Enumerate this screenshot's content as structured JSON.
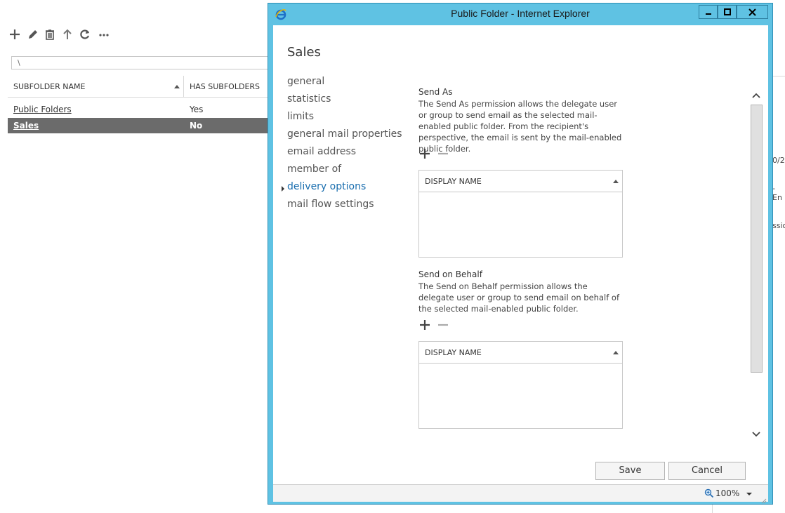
{
  "window": {
    "title": "Public Folder - Internet Explorer"
  },
  "dialog": {
    "title": "Sales",
    "nav": [
      "general",
      "statistics",
      "limits",
      "general mail properties",
      "email address",
      "member of",
      "delivery options",
      "mail flow settings"
    ],
    "active_nav": "delivery options",
    "send_as": {
      "title": "Send As",
      "description": "The Send As permission allows the delegate user or group to send email as the selected mail-enabled public folder. From the recipient's perspective, the email is sent by the mail-enabled public folder.",
      "column": "DISPLAY NAME"
    },
    "send_on_behalf": {
      "title": "Send on Behalf",
      "description": "The Send on Behalf permission allows the delegate user or group to send email on behalf of the selected mail-enabled public folder.",
      "column": "DISPLAY NAME"
    },
    "save_label": "Save",
    "cancel_label": "Cancel"
  },
  "statusbar": {
    "zoom": "100%"
  },
  "background": {
    "path": "\\",
    "columns": [
      "SUBFOLDER NAME",
      "HAS SUBFOLDERS"
    ],
    "rows": [
      {
        "name": "Public Folders",
        "has_subfolders": "Yes"
      },
      {
        "name": "Sales",
        "has_subfolders": "No"
      }
    ],
    "edge_texts": [
      "0/2",
      "- En",
      "ssio"
    ]
  },
  "colors": {
    "title_bar": "#5fc2e3",
    "accent_link": "#1a6eaf",
    "selected_row": "#6b6b6b"
  }
}
